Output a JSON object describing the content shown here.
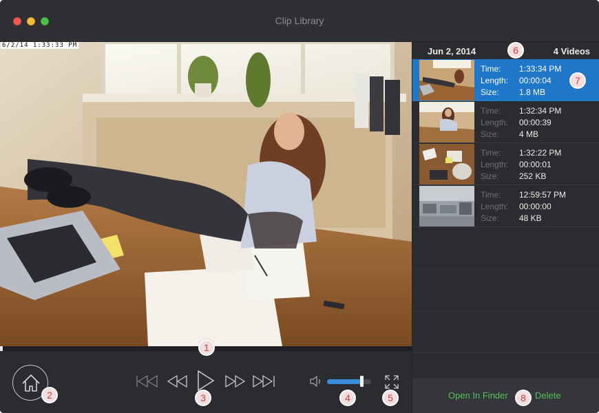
{
  "window": {
    "title": "Clip Library"
  },
  "video": {
    "timestamp_overlay": "6/2/14  1:33:33 PM"
  },
  "playback": {
    "progress": 0.0
  },
  "volume": {
    "level": 0.78
  },
  "icons": {
    "home": "home-icon",
    "skip_back": "skip-to-start-icon",
    "rewind": "rewind-icon",
    "play": "play-icon",
    "fast_forward": "fast-forward-icon",
    "skip_forward": "skip-to-end-icon",
    "volume": "speaker-icon",
    "fullscreen": "fullscreen-icon"
  },
  "panel": {
    "date": "Jun 2, 2014",
    "count": "4 Videos",
    "labels": {
      "time": "Time:",
      "length": "Length:",
      "size": "Size:"
    },
    "items": [
      {
        "time": "1:33:34 PM",
        "length": "00:00:04",
        "size": "1.8 MB",
        "selected": true
      },
      {
        "time": "1:32:34 PM",
        "length": "00:00:39",
        "size": "4 MB",
        "selected": false
      },
      {
        "time": "1:32:22 PM",
        "length": "00:00:01",
        "size": "252 KB",
        "selected": false
      },
      {
        "time": "12:59:57 PM",
        "length": "00:00:00",
        "size": "48 KB",
        "selected": false
      }
    ],
    "footer": {
      "open_in_finder": "Open In Finder",
      "delete": "Delete"
    }
  },
  "callouts": [
    "1",
    "2",
    "3",
    "4",
    "5",
    "6",
    "7",
    "8"
  ],
  "colors": {
    "accent": "#1f77c9",
    "footer_link": "#57c05a",
    "volume_fill": "#3a8ddc"
  }
}
